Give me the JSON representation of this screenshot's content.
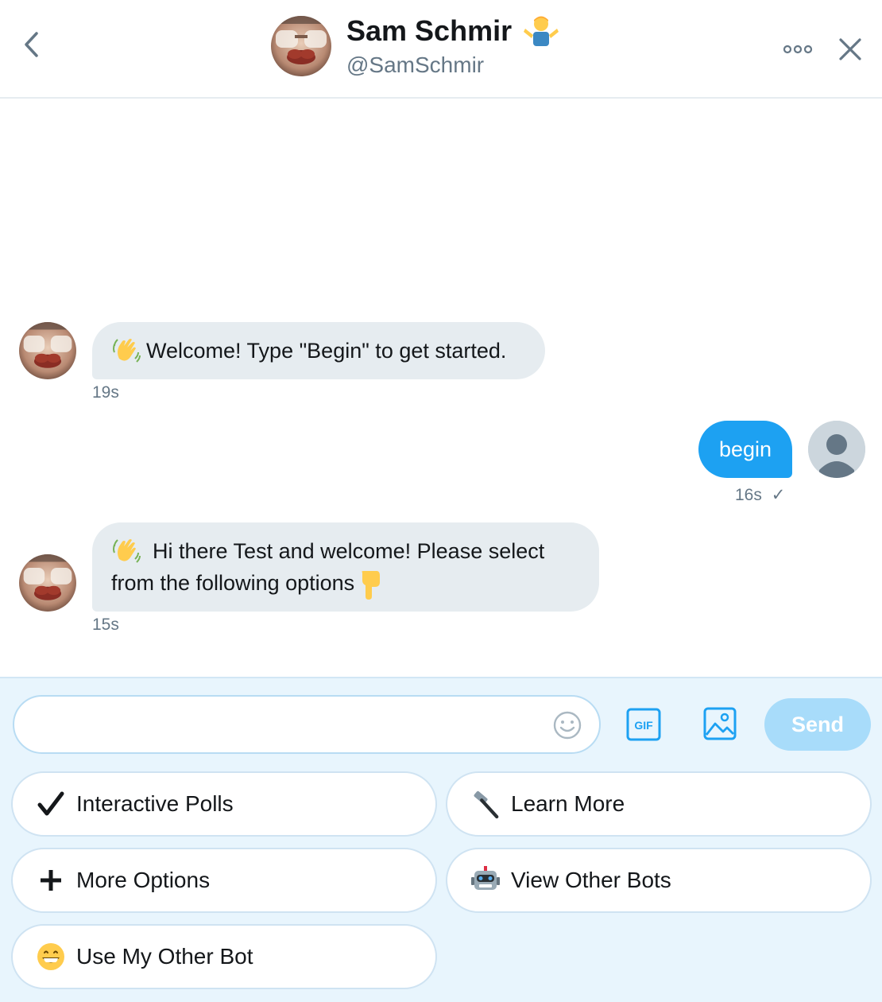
{
  "header": {
    "name": "Sam Schmir",
    "handle": "@SamSchmir",
    "name_emoji": "person-shrugging-emoji"
  },
  "messages": [
    {
      "direction": "incoming",
      "text": "Welcome! Type \"Begin\" to get started.",
      "emoji": "waving-hand-emoji",
      "time": "19s"
    },
    {
      "direction": "outgoing",
      "text": "begin",
      "time": "16s",
      "read_mark": "✓"
    },
    {
      "direction": "incoming",
      "text_line1": "Hi there Test and welcome! Please select",
      "text_line2": "from the following options",
      "emoji": "waving-hand-emoji",
      "trailing_emoji": "backhand-index-pointing-down-emoji",
      "time": "15s"
    }
  ],
  "composer": {
    "value": "",
    "placeholder": "",
    "gif_label": "GIF",
    "send_label": "Send"
  },
  "quick_replies": [
    {
      "label": "Interactive Polls",
      "icon": "check-mark-icon"
    },
    {
      "label": "Learn More",
      "icon": "hammer-icon"
    },
    {
      "label": "More Options",
      "icon": "plus-icon"
    },
    {
      "label": "View Other Bots",
      "icon": "robot-icon"
    },
    {
      "label": "Use My Other Bot",
      "icon": "grinning-face-icon"
    }
  ],
  "colors": {
    "accent": "#1da1f2",
    "send_disabled": "#a8dcfa",
    "incoming_bubble": "#e6ecf0",
    "composer_bg": "#e8f5fd"
  }
}
